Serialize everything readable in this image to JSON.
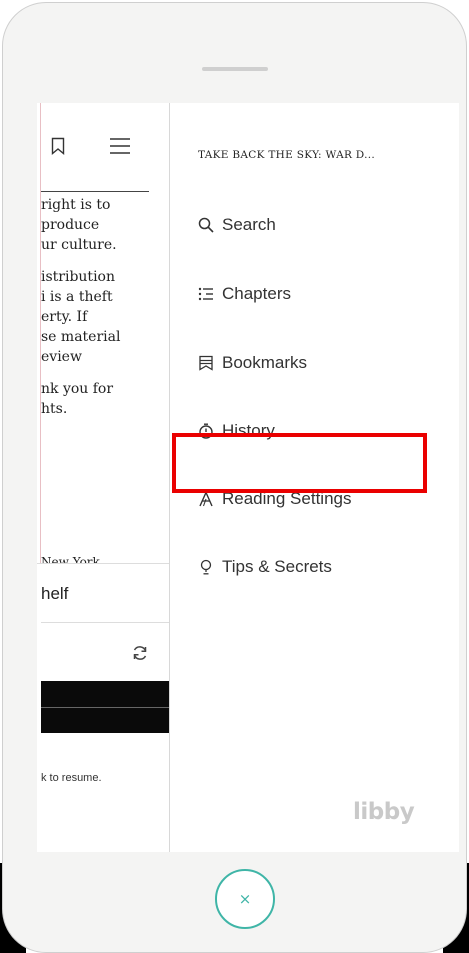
{
  "book": {
    "text_lines": [
      [
        "right is to",
        "produce",
        "ur culture."
      ],
      [
        "istribution",
        "i is a theft",
        "erty. If",
        "se material",
        "eview"
      ],
      [
        "nk you for",
        "hts."
      ]
    ],
    "cut_line": "New York",
    "shelf_label": "helf",
    "resume_text": "k to resume."
  },
  "menu": {
    "book_title": "TAKE BACK THE SKY: WAR D...",
    "items": [
      {
        "label": "Search",
        "icon": "search-icon"
      },
      {
        "label": "Chapters",
        "icon": "chapters-icon"
      },
      {
        "label": "Bookmarks",
        "icon": "bookmarks-icon"
      },
      {
        "label": "History",
        "icon": "history-icon"
      },
      {
        "label": "Reading Settings",
        "icon": "reading-settings-icon"
      },
      {
        "label": "Tips & Secrets",
        "icon": "tips-icon"
      }
    ],
    "brand": "libby"
  },
  "close_button": {
    "glyph": "×"
  },
  "colors": {
    "accent": "#3fb5a7",
    "highlight": "#ea0000"
  }
}
